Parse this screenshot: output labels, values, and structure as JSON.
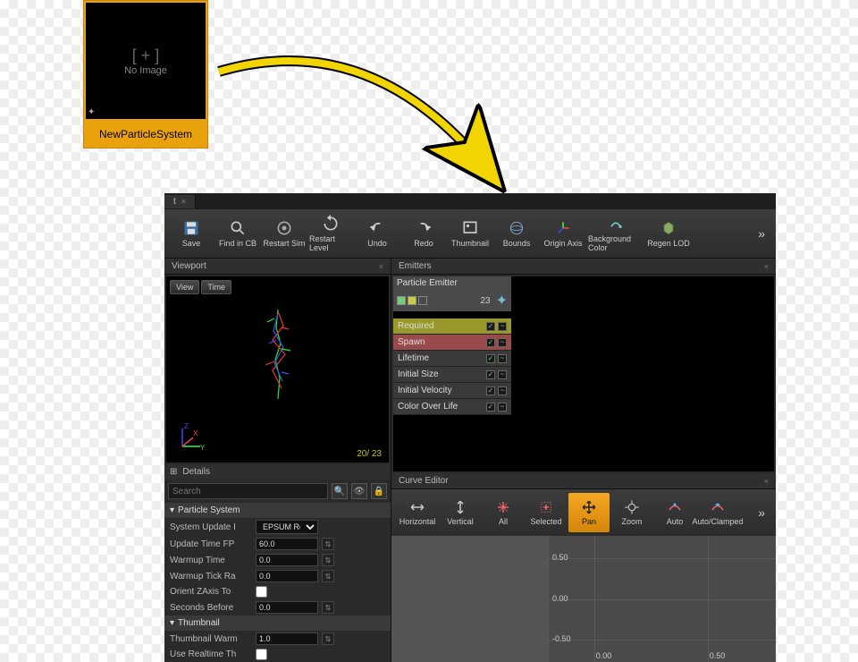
{
  "asset_thumb": {
    "no_image": "No Image",
    "label": "NewParticleSystem",
    "plus": "[ + ]"
  },
  "tabs": {
    "main": "t"
  },
  "toolbar": [
    {
      "id": "save",
      "label": "Save"
    },
    {
      "id": "findcb",
      "label": "Find in CB"
    },
    {
      "id": "restartsim",
      "label": "Restart Sim"
    },
    {
      "id": "restartlevel",
      "label": "Restart Level"
    },
    {
      "id": "undo",
      "label": "Undo"
    },
    {
      "id": "redo",
      "label": "Redo"
    },
    {
      "id": "thumbnail",
      "label": "Thumbnail"
    },
    {
      "id": "bounds",
      "label": "Bounds"
    },
    {
      "id": "originaxis",
      "label": "Origin Axis"
    },
    {
      "id": "bgcolor",
      "label": "Background Color"
    },
    {
      "id": "regenlod",
      "label": "Regen LOD"
    }
  ],
  "viewport": {
    "title": "Viewport",
    "view": "View",
    "time": "Time",
    "counter": "20/ 23",
    "axes": {
      "x": "X",
      "y": "Y",
      "z": "Z"
    }
  },
  "emitters": {
    "title": "Emitters",
    "name": "Particle Emitter",
    "count": "23",
    "modules": [
      {
        "label": "Required",
        "cls": "required"
      },
      {
        "label": "Spawn",
        "cls": "spawn"
      },
      {
        "label": "Lifetime",
        "cls": ""
      },
      {
        "label": "Initial Size",
        "cls": ""
      },
      {
        "label": "Initial Velocity",
        "cls": ""
      },
      {
        "label": "Color Over Life",
        "cls": ""
      }
    ]
  },
  "curve": {
    "title": "Curve Editor",
    "buttons": [
      {
        "id": "horizontal",
        "label": "Horizontal"
      },
      {
        "id": "vertical",
        "label": "Vertical"
      },
      {
        "id": "all",
        "label": "All"
      },
      {
        "id": "selected",
        "label": "Selected"
      },
      {
        "id": "pan",
        "label": "Pan",
        "active": true
      },
      {
        "id": "zoom",
        "label": "Zoom"
      },
      {
        "id": "auto",
        "label": "Auto"
      },
      {
        "id": "autoclamped",
        "label": "Auto/Clamped"
      }
    ],
    "ylabels": [
      "0.50",
      "0.00",
      "-0.50"
    ],
    "xlabels": [
      "0.00",
      "0.50"
    ]
  },
  "details": {
    "title": "Details",
    "search_placeholder": "Search",
    "section_ps": "Particle System",
    "props": [
      {
        "label": "System Update I",
        "value": "EPSUM Real Time",
        "type": "select"
      },
      {
        "label": "Update Time FP",
        "value": "60.0",
        "type": "num"
      },
      {
        "label": "Warmup Time",
        "value": "0.0",
        "type": "num"
      },
      {
        "label": "Warmup Tick Ra",
        "value": "0.0",
        "type": "num"
      },
      {
        "label": "Orient ZAxis To",
        "value": "",
        "type": "check"
      },
      {
        "label": "Seconds Before",
        "value": "0.0",
        "type": "num"
      }
    ],
    "section_thumb": "Thumbnail",
    "thumb_props": [
      {
        "label": "Thumbnail Warm",
        "value": "1.0",
        "type": "num"
      },
      {
        "label": "Use Realtime Th",
        "value": "",
        "type": "check"
      }
    ]
  }
}
